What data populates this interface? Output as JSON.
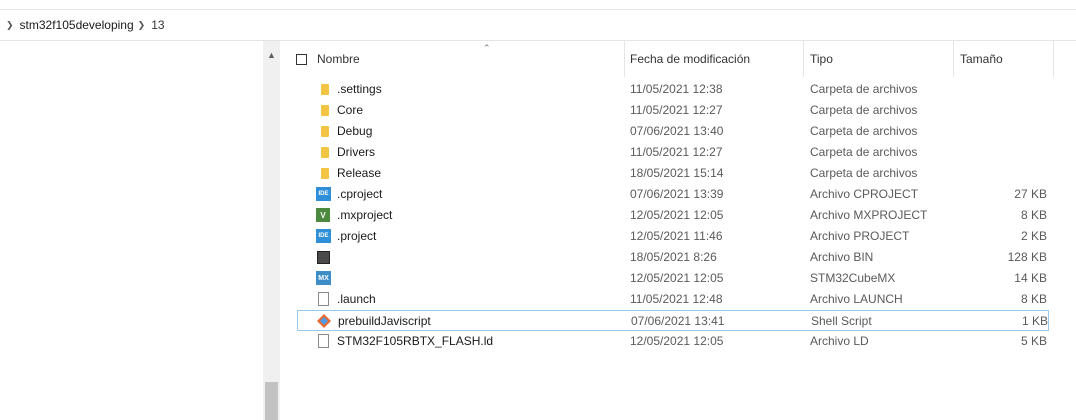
{
  "breadcrumb": {
    "segments": [
      "stm32f105developing",
      "13"
    ]
  },
  "columns": {
    "name": "Nombre",
    "date": "Fecha de modificación",
    "type": "Tipo",
    "size": "Tamaño"
  },
  "files": [
    {
      "name": ".settings",
      "date": "11/05/2021 12:38",
      "type": "Carpeta de archivos",
      "size": "",
      "icon": "folder-icon"
    },
    {
      "name": "Core",
      "date": "11/05/2021 12:27",
      "type": "Carpeta de archivos",
      "size": "",
      "icon": "folder-icon"
    },
    {
      "name": "Debug",
      "date": "07/06/2021 13:40",
      "type": "Carpeta de archivos",
      "size": "",
      "icon": "folder-icon"
    },
    {
      "name": "Drivers",
      "date": "11/05/2021 12:27",
      "type": "Carpeta de archivos",
      "size": "",
      "icon": "folder-icon"
    },
    {
      "name": "Release",
      "date": "18/05/2021 15:14",
      "type": "Carpeta de archivos",
      "size": "",
      "icon": "folder-icon"
    },
    {
      "name": ".cproject",
      "date": "07/06/2021 13:39",
      "type": "Archivo CPROJECT",
      "size": "27 KB",
      "icon": "ide-icon",
      "badge": "IDE"
    },
    {
      "name": ".mxproject",
      "date": "12/05/2021 12:05",
      "type": "Archivo MXPROJECT",
      "size": "8 KB",
      "icon": "mxproject-icon",
      "badge": "V"
    },
    {
      "name": ".project",
      "date": "12/05/2021 11:46",
      "type": "Archivo PROJECT",
      "size": "2 KB",
      "icon": "ide-icon",
      "badge": "IDE"
    },
    {
      "name": "",
      "date": "18/05/2021 8:26",
      "type": "Archivo BIN",
      "size": "128 KB",
      "icon": "bin-icon"
    },
    {
      "name": "",
      "date": "12/05/2021 12:05",
      "type": "STM32CubeMX",
      "size": "14 KB",
      "icon": "cubemx-icon",
      "badge": "MX"
    },
    {
      "name": ".launch",
      "date": "11/05/2021 12:48",
      "type": "Archivo LAUNCH",
      "size": "8 KB",
      "icon": "document-icon"
    },
    {
      "name": "prebuildJaviscript",
      "date": "07/06/2021 13:41",
      "type": "Shell Script",
      "size": "1 KB",
      "icon": "shell-script-icon",
      "selected": true
    },
    {
      "name": "STM32F105RBTX_FLASH.ld",
      "date": "12/05/2021 12:05",
      "type": "Archivo LD",
      "size": "5 KB",
      "icon": "document-icon"
    }
  ]
}
